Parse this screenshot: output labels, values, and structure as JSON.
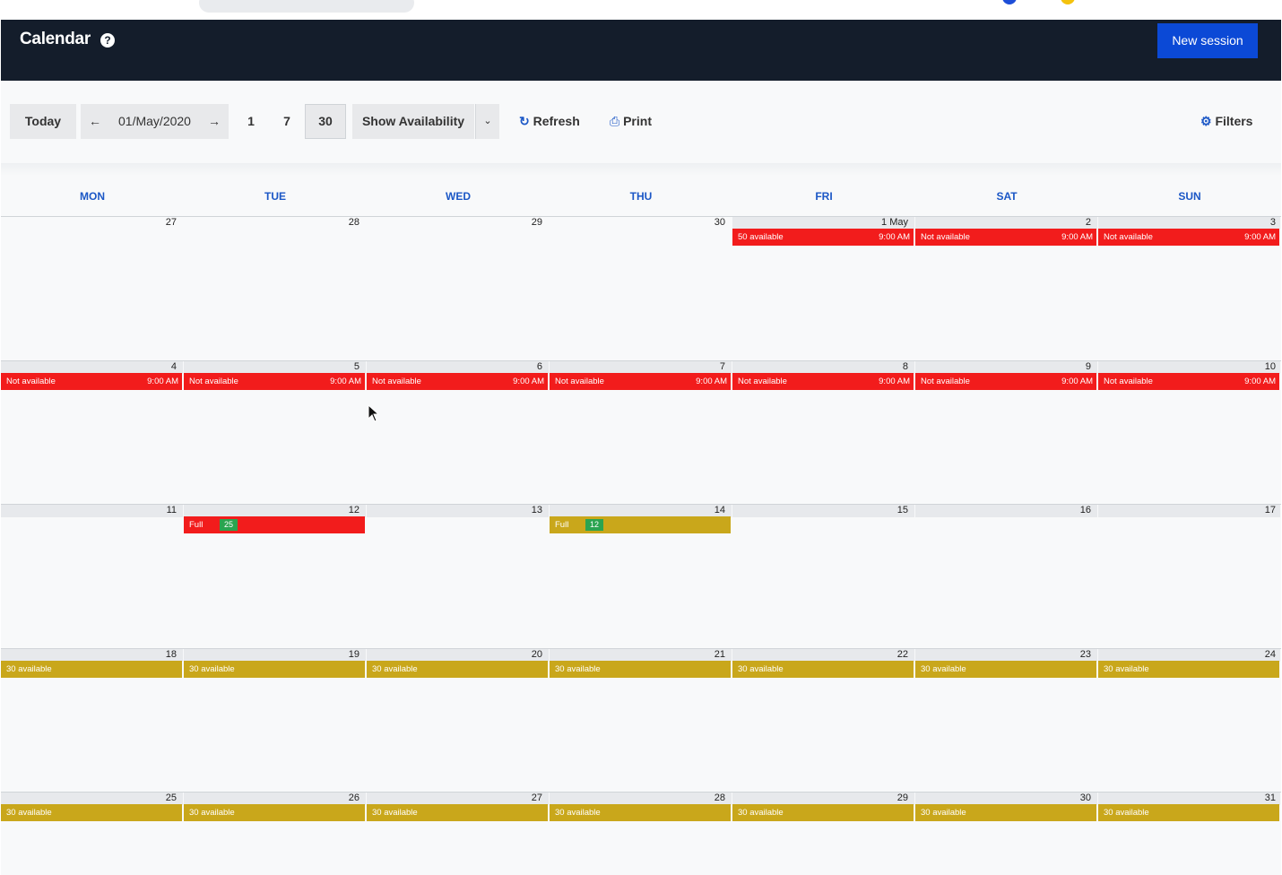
{
  "header": {
    "title": "Calendar",
    "new_session_label": "New session"
  },
  "toolbar": {
    "today": "Today",
    "date": "01/May/2020",
    "view_1": "1",
    "view_7": "7",
    "view_30": "30",
    "show_availability": "Show Availability",
    "refresh": "Refresh",
    "print": "Print",
    "filters": "Filters"
  },
  "days_of_week": [
    "MON",
    "TUE",
    "WED",
    "THU",
    "FRI",
    "SAT",
    "SUN"
  ],
  "weeks": [
    [
      "27",
      "28",
      "29",
      "30",
      "1 May",
      "2",
      "3"
    ],
    [
      "4",
      "5",
      "6",
      "7",
      "8",
      "9",
      "10"
    ],
    [
      "11",
      "12",
      "13",
      "14",
      "15",
      "16",
      "17"
    ],
    [
      "18",
      "19",
      "20",
      "21",
      "22",
      "23",
      "24"
    ],
    [
      "25",
      "26",
      "27",
      "28",
      "29",
      "30",
      "31"
    ]
  ],
  "events": [
    {
      "week": 0,
      "day": 4,
      "label": "50 available",
      "time": "9:00 AM",
      "color": "red"
    },
    {
      "week": 0,
      "day": 5,
      "label": "Not available",
      "time": "9:00 AM",
      "color": "red"
    },
    {
      "week": 0,
      "day": 6,
      "label": "Not available",
      "time": "9:00 AM",
      "color": "red"
    },
    {
      "week": 1,
      "day": 0,
      "label": "Not available",
      "time": "9:00 AM",
      "color": "red"
    },
    {
      "week": 1,
      "day": 1,
      "label": "Not available",
      "time": "9:00 AM",
      "color": "red"
    },
    {
      "week": 1,
      "day": 2,
      "label": "Not available",
      "time": "9:00 AM",
      "color": "red"
    },
    {
      "week": 1,
      "day": 3,
      "label": "Not available",
      "time": "9:00 AM",
      "color": "red"
    },
    {
      "week": 1,
      "day": 4,
      "label": "Not available",
      "time": "9:00 AM",
      "color": "red"
    },
    {
      "week": 1,
      "day": 5,
      "label": "Not available",
      "time": "9:00 AM",
      "color": "red"
    },
    {
      "week": 1,
      "day": 6,
      "label": "Not available",
      "time": "9:00 AM",
      "color": "red"
    },
    {
      "week": 2,
      "day": 1,
      "label": "Full",
      "badge": "25",
      "color": "red"
    },
    {
      "week": 2,
      "day": 3,
      "label": "Full",
      "badge": "12",
      "color": "gold"
    },
    {
      "week": 3,
      "day": 0,
      "label": "30 available",
      "color": "gold"
    },
    {
      "week": 3,
      "day": 1,
      "label": "30 available",
      "color": "gold"
    },
    {
      "week": 3,
      "day": 2,
      "label": "30 available",
      "color": "gold"
    },
    {
      "week": 3,
      "day": 3,
      "label": "30 available",
      "color": "gold"
    },
    {
      "week": 3,
      "day": 4,
      "label": "30 available",
      "color": "gold"
    },
    {
      "week": 3,
      "day": 5,
      "label": "30 available",
      "color": "gold"
    },
    {
      "week": 3,
      "day": 6,
      "label": "30 available",
      "color": "gold"
    },
    {
      "week": 4,
      "day": 0,
      "label": "30 available",
      "color": "gold"
    },
    {
      "week": 4,
      "day": 1,
      "label": "30 available",
      "color": "gold"
    },
    {
      "week": 4,
      "day": 2,
      "label": "30 available",
      "color": "gold"
    },
    {
      "week": 4,
      "day": 3,
      "label": "30 available",
      "color": "gold"
    },
    {
      "week": 4,
      "day": 4,
      "label": "30 available",
      "color": "gold"
    },
    {
      "week": 4,
      "day": 5,
      "label": "30 available",
      "color": "gold"
    },
    {
      "week": 4,
      "day": 6,
      "label": "30 available",
      "color": "gold"
    }
  ],
  "colors": {
    "header_bg": "#141d2b",
    "primary": "#0b49d6",
    "red": "#f21c1c",
    "gold": "#c9a71b",
    "badge": "#2aa450",
    "dow": "#1b57c6"
  }
}
